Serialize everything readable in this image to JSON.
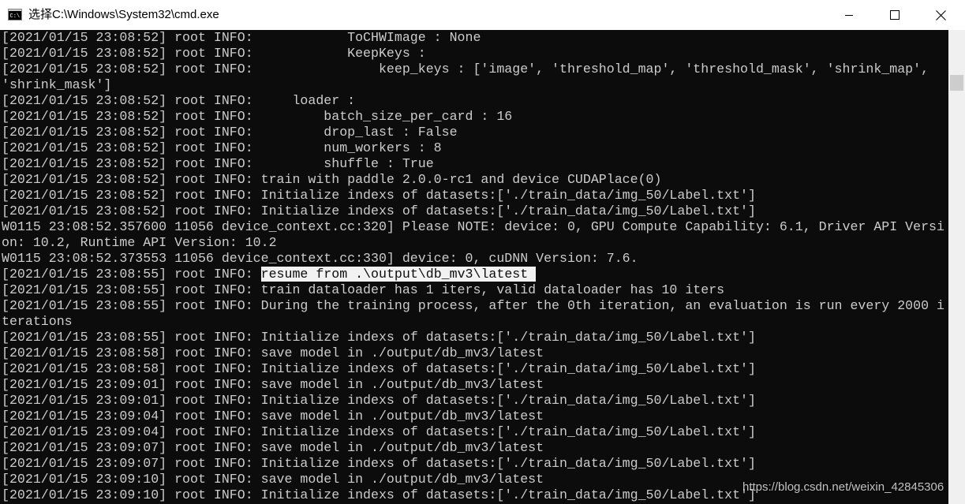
{
  "window": {
    "title": "选择C:\\Windows\\System32\\cmd.exe",
    "app_icon": "cmd-icon",
    "controls": {
      "minimize": "minimize-icon",
      "maximize": "maximize-icon",
      "close": "close-icon"
    }
  },
  "colors": {
    "console_bg": "#0c0c0c",
    "console_fg": "#cccccc",
    "selection_bg": "#f2f2f2",
    "titlebar_bg": "#ffffff"
  },
  "console": {
    "lines": [
      "[2021/01/15 23:08:52] root INFO:            ToCHWImage : None",
      "[2021/01/15 23:08:52] root INFO:            KeepKeys :",
      "[2021/01/15 23:08:52] root INFO:                keep_keys : ['image', 'threshold_map', 'threshold_mask', 'shrink_map',",
      "'shrink_mask']",
      "[2021/01/15 23:08:52] root INFO:     loader :",
      "[2021/01/15 23:08:52] root INFO:         batch_size_per_card : 16",
      "[2021/01/15 23:08:52] root INFO:         drop_last : False",
      "[2021/01/15 23:08:52] root INFO:         num_workers : 8",
      "[2021/01/15 23:08:52] root INFO:         shuffle : True",
      "[2021/01/15 23:08:52] root INFO: train with paddle 2.0.0-rc1 and device CUDAPlace(0)",
      "[2021/01/15 23:08:52] root INFO: Initialize indexs of datasets:['./train_data/img_50/Label.txt']",
      "[2021/01/15 23:08:52] root INFO: Initialize indexs of datasets:['./train_data/img_50/Label.txt']",
      "W0115 23:08:52.357600 11056 device_context.cc:320] Please NOTE: device: 0, GPU Compute Capability: 6.1, Driver API Versi",
      "on: 10.2, Runtime API Version: 10.2",
      "W0115 23:08:52.373553 11056 device_context.cc:330] device: 0, cuDNN Version: 7.6.",
      "[2021/01/15 23:08:55] root INFO: ",
      "[2021/01/15 23:08:55] root INFO: train dataloader has 1 iters, valid dataloader has 10 iters",
      "[2021/01/15 23:08:55] root INFO: During the training process, after the 0th iteration, an evaluation is run every 2000 i",
      "terations",
      "[2021/01/15 23:08:55] root INFO: Initialize indexs of datasets:['./train_data/img_50/Label.txt']",
      "[2021/01/15 23:08:58] root INFO: save model in ./output/db_mv3/latest",
      "[2021/01/15 23:08:58] root INFO: Initialize indexs of datasets:['./train_data/img_50/Label.txt']",
      "[2021/01/15 23:09:01] root INFO: save model in ./output/db_mv3/latest",
      "[2021/01/15 23:09:01] root INFO: Initialize indexs of datasets:['./train_data/img_50/Label.txt']",
      "[2021/01/15 23:09:04] root INFO: save model in ./output/db_mv3/latest",
      "[2021/01/15 23:09:04] root INFO: Initialize indexs of datasets:['./train_data/img_50/Label.txt']",
      "[2021/01/15 23:09:07] root INFO: save model in ./output/db_mv3/latest",
      "[2021/01/15 23:09:07] root INFO: Initialize indexs of datasets:['./train_data/img_50/Label.txt']",
      "[2021/01/15 23:09:10] root INFO: save model in ./output/db_mv3/latest",
      "[2021/01/15 23:09:10] root INFO: Initialize indexs of datasets:['./train_data/img_50/Label.txt']"
    ],
    "selected_text": "resume from .\\output\\db_mv3\\latest "
  },
  "watermark": "https://blog.csdn.net/weixin_42845306"
}
